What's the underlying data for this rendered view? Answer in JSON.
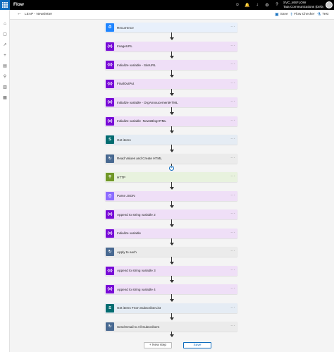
{
  "app": {
    "title": "Flow",
    "account": "SVC_MSFLOW",
    "org": "Tata Communications (Defa"
  },
  "topbar_icons": [
    "smiley-icon",
    "bell-icon",
    "download-icon",
    "gear-icon",
    "help-icon"
  ],
  "topbar_glyphs": [
    "☺",
    "🔔",
    "↓",
    "⚙",
    "?"
  ],
  "left_nav": [
    {
      "name": "nav-home-icon",
      "glyph": "⌂"
    },
    {
      "name": "nav-action-items-icon",
      "glyph": "▢"
    },
    {
      "name": "nav-my-flows-icon",
      "glyph": "↗"
    },
    {
      "name": "nav-create-icon",
      "glyph": "+"
    },
    {
      "name": "nav-templates-icon",
      "glyph": "▤"
    },
    {
      "name": "nav-connectors-icon",
      "glyph": "⚲"
    },
    {
      "name": "nav-data-icon",
      "glyph": "▥"
    },
    {
      "name": "nav-solutions-icon",
      "glyph": "▦"
    }
  ],
  "command_bar": {
    "breadcrumb": "LEAP - Newsletter",
    "save_label": "Save",
    "flow_checker_label": "Flow Checker",
    "test_label": "Test"
  },
  "steps": [
    {
      "label": "Recurrence",
      "type": "recurrence",
      "icon": "⏱",
      "bg": "#e8f0fb",
      "icon_bg": "#1f85ff"
    },
    {
      "label": "ImageURL",
      "type": "variable",
      "icon": "{x}",
      "bg": "#efdff7",
      "icon_bg": "#770bd6"
    },
    {
      "label": "Initialize variable - SiteURL",
      "type": "variable",
      "icon": "{x}",
      "bg": "#efdff7",
      "icon_bg": "#770bd6"
    },
    {
      "label": "FinalOutPut",
      "type": "variable",
      "icon": "{x}",
      "bg": "#efdff7",
      "icon_bg": "#770bd6"
    },
    {
      "label": "Initialize variable - OrgAnnoucementHTML",
      "type": "variable",
      "icon": "{x}",
      "bg": "#efdff7",
      "icon_bg": "#770bd6"
    },
    {
      "label": "Initialize variable -NewsBlogHTML",
      "type": "variable",
      "icon": "{x}",
      "bg": "#efdff7",
      "icon_bg": "#770bd6"
    },
    {
      "label": "Get items",
      "type": "sharepoint",
      "icon": "S",
      "bg": "#e5ecf4",
      "icon_bg": "#036c70"
    },
    {
      "label": "Read Values and Create HTML",
      "type": "apply",
      "icon": "↻",
      "bg": "#ebebeb",
      "icon_bg": "#486991"
    },
    {
      "label": "HTTP",
      "type": "http",
      "icon": "⚲",
      "bg": "#e8f2de",
      "icon_bg": "#709727"
    },
    {
      "label": "Parse JSON",
      "type": "data",
      "icon": "{}",
      "bg": "#efdff7",
      "icon_bg": "#8c6cff"
    },
    {
      "label": "Append to string variable 2",
      "type": "variable",
      "icon": "{x}",
      "bg": "#efdff7",
      "icon_bg": "#770bd6"
    },
    {
      "label": "Initialize variable",
      "type": "variable",
      "icon": "{x}",
      "bg": "#efdff7",
      "icon_bg": "#770bd6"
    },
    {
      "label": "Apply to each",
      "type": "apply",
      "icon": "↻",
      "bg": "#ebebeb",
      "icon_bg": "#486991"
    },
    {
      "label": "Append to string variable 3",
      "type": "variable",
      "icon": "{x}",
      "bg": "#efdff7",
      "icon_bg": "#770bd6"
    },
    {
      "label": "Append to string variable 4",
      "type": "variable",
      "icon": "{x}",
      "bg": "#efdff7",
      "icon_bg": "#770bd6"
    },
    {
      "label": "Get items From SubscriberList",
      "type": "sharepoint",
      "icon": "S",
      "bg": "#e5ecf4",
      "icon_bg": "#036c70"
    },
    {
      "label": "Send Email to All Subscribers",
      "type": "apply",
      "icon": "↻",
      "bg": "#ebebeb",
      "icon_bg": "#486991"
    }
  ],
  "step_menu_glyph": "···",
  "insert_glyph": "+",
  "bottom": {
    "new_step_label": "+ New step",
    "save_label": "Save"
  },
  "colors": {
    "accent": "#0f6cbd",
    "topbar": "#000000"
  }
}
